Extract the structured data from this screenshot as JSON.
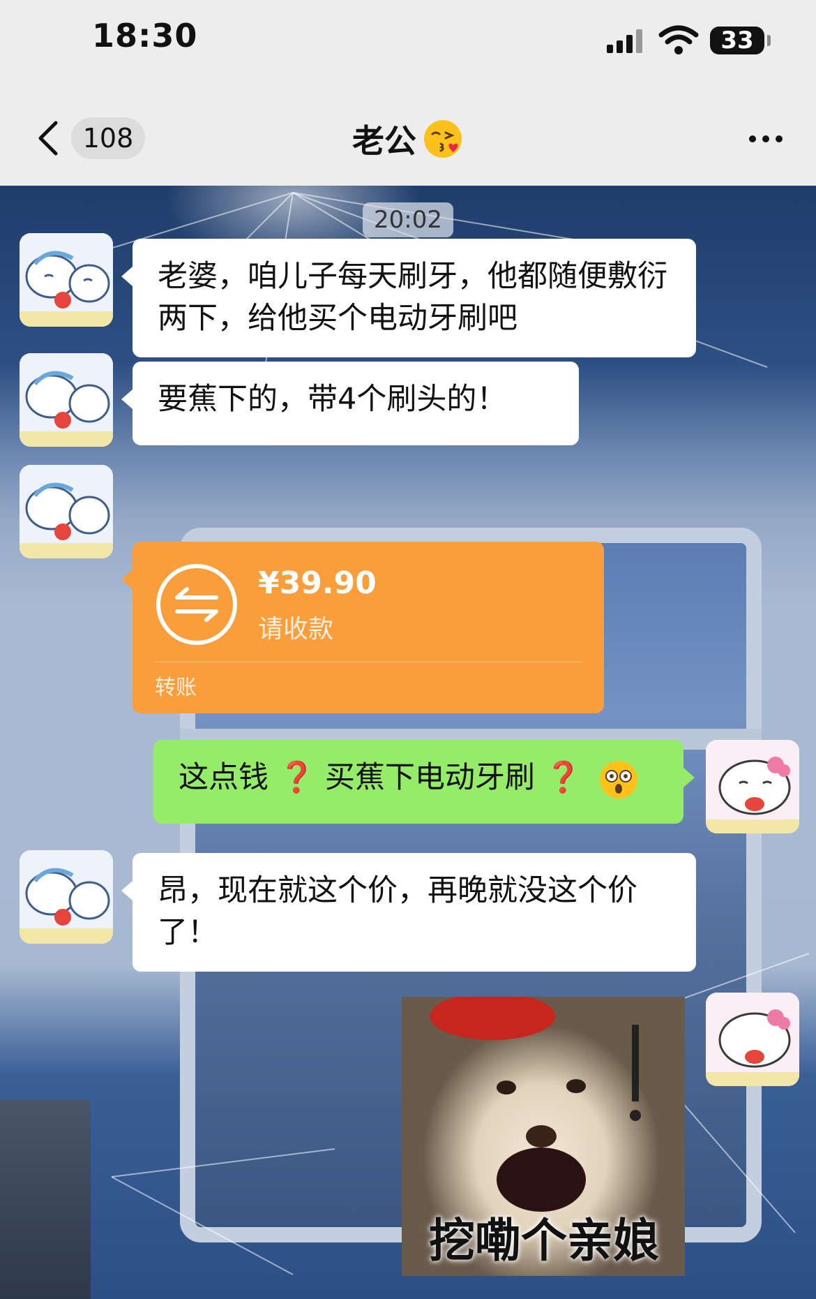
{
  "status_bar": {
    "time": "18:30",
    "battery": "33"
  },
  "nav": {
    "unread_count": "108",
    "title": "老公",
    "title_emoji": "kissing-heart-emoji"
  },
  "chat": {
    "timestamp": "20:02",
    "messages": [
      {
        "from": "other",
        "text": "老婆，咱儿子每天刷牙，他都随便敷衍两下，给他买个电动牙刷吧"
      },
      {
        "from": "other",
        "text": "要蕉下的，带4个刷头的！"
      },
      {
        "from": "other",
        "type": "transfer",
        "amount": "¥39.90",
        "status": "请收款",
        "label": "转账"
      },
      {
        "from": "me",
        "parts": [
          "这点钱",
          "❓",
          "买蕉下电动牙刷",
          "❓"
        ],
        "emoji": "flushed-face-emoji"
      },
      {
        "from": "other",
        "text": "昂，现在就这个价，再晚就没这个价了！"
      },
      {
        "from": "me",
        "type": "sticker",
        "caption": "挖嘞个亲娘"
      }
    ]
  },
  "colors": {
    "bubble_green": "#95ec69",
    "transfer_orange": "#fa9d3b",
    "bg": "#ededed"
  }
}
